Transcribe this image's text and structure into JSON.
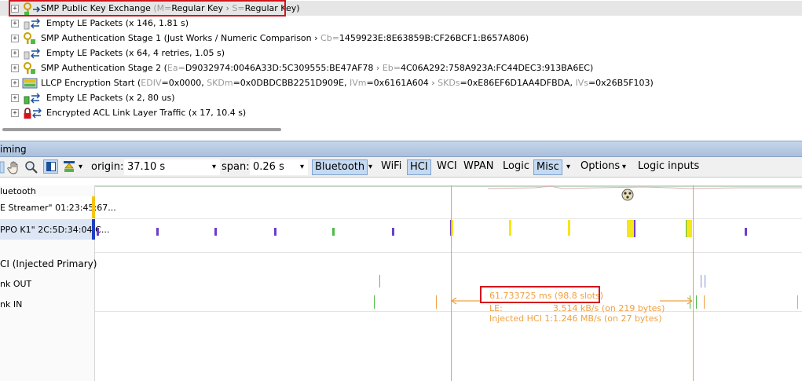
{
  "packets": [
    {
      "type": "smp-key",
      "label": "SMP Public Key Exchange",
      "paren_open": " (",
      "k1": "M",
      "eq1": "=",
      "v1": "Regular Key",
      "sep": " › ",
      "k2": "S",
      "eq2": "=",
      "v2": "Regular Key",
      "paren_close": ")"
    },
    {
      "type": "empty",
      "label": "Empty LE Packets",
      "detail": " (x 146, 1.81 s)"
    },
    {
      "type": "smp-auth1",
      "label": "SMP Authentication Stage 1 (Just Works / Numeric Comparison › ",
      "k1": "Cb",
      "eq1": "=",
      "v1": "1459923E:8E63859B:CF26BCF1:B657A806",
      "close": ")"
    },
    {
      "type": "empty",
      "label": "Empty LE Packets",
      "detail": " (x 64, 4 retries, 1.05 s)"
    },
    {
      "type": "smp-auth2",
      "label": "SMP Authentication Stage 2 (",
      "k1": "Ea",
      "eq1": "=",
      "v1": "D9032974:0046A33D:5C309555:BE47AF78",
      "sep": " › ",
      "k2": "Eb",
      "eq2": "=",
      "v2": "4C06A292:758A923A:FC44DEC3:913BA6EC",
      "close": ")"
    },
    {
      "type": "llcp",
      "label": "LLCP Encryption Start (",
      "k1": "EDIV",
      "v1": "=0x0000, ",
      "k2": "SKDm",
      "v2": "=0x0DBDCBB2251D909E, ",
      "k3": "IVm",
      "v3": "=0x6161A604",
      "sep": " › ",
      "k4": "SKDs",
      "v4": "=0xE86EF6D1AA4DFBDA, ",
      "k5": "IVs",
      "v5": "=0x26B5F103",
      "close": ")"
    },
    {
      "type": "empty",
      "label": "Empty LE Packets",
      "detail": " (x 2, 80 us)"
    },
    {
      "type": "encrypted",
      "label": "Encrypted ACL Link Layer Traffic",
      "detail": "  (x 17, 10.4 s)"
    }
  ],
  "timing": {
    "title": "iming",
    "origin_label": "origin:",
    "origin_value": "37.10 s",
    "span_label": "span:",
    "span_value": "0.26 s",
    "filters": [
      {
        "label": "Bluetooth",
        "on": true,
        "dropdown": true
      },
      {
        "label": "WiFi",
        "on": false,
        "dropdown": false
      },
      {
        "label": "HCI",
        "on": true,
        "dropdown": false
      },
      {
        "label": "WCI",
        "on": false,
        "dropdown": false
      },
      {
        "label": "WPAN",
        "on": false,
        "dropdown": false
      },
      {
        "label": "Logic",
        "on": false,
        "dropdown": false
      },
      {
        "label": "Misc",
        "on": true,
        "dropdown": true
      }
    ],
    "options_label": "Options",
    "logic_inputs_label": "Logic inputs"
  },
  "lanes": [
    {
      "label": "luetooth"
    },
    {
      "label": "E Streamer\" 01:23:45:67..."
    },
    {
      "label": "PPO K1\" 2C:5D:34:04:C..."
    },
    {
      "label": "CI (Injected Primary)"
    },
    {
      "label": "nk OUT"
    },
    {
      "label": "nk IN"
    }
  ],
  "measurement": {
    "duration": "61.733725 ms  (98.8 slots)",
    "le_label": "LE:",
    "le_value": "3.514 kB/s (on 219 bytes)",
    "hci_label": "Injected HCI 1:",
    "hci_value": "1.246 MB/s (on 27 bytes)"
  },
  "colors": {
    "accent": "#f0a040",
    "highlight": "#d4141c",
    "marker_purple": "#6a3fc9",
    "marker_yellow": "#f5e61a",
    "marker_green": "#50b848",
    "toolbar_on": "#c5d9f1"
  }
}
